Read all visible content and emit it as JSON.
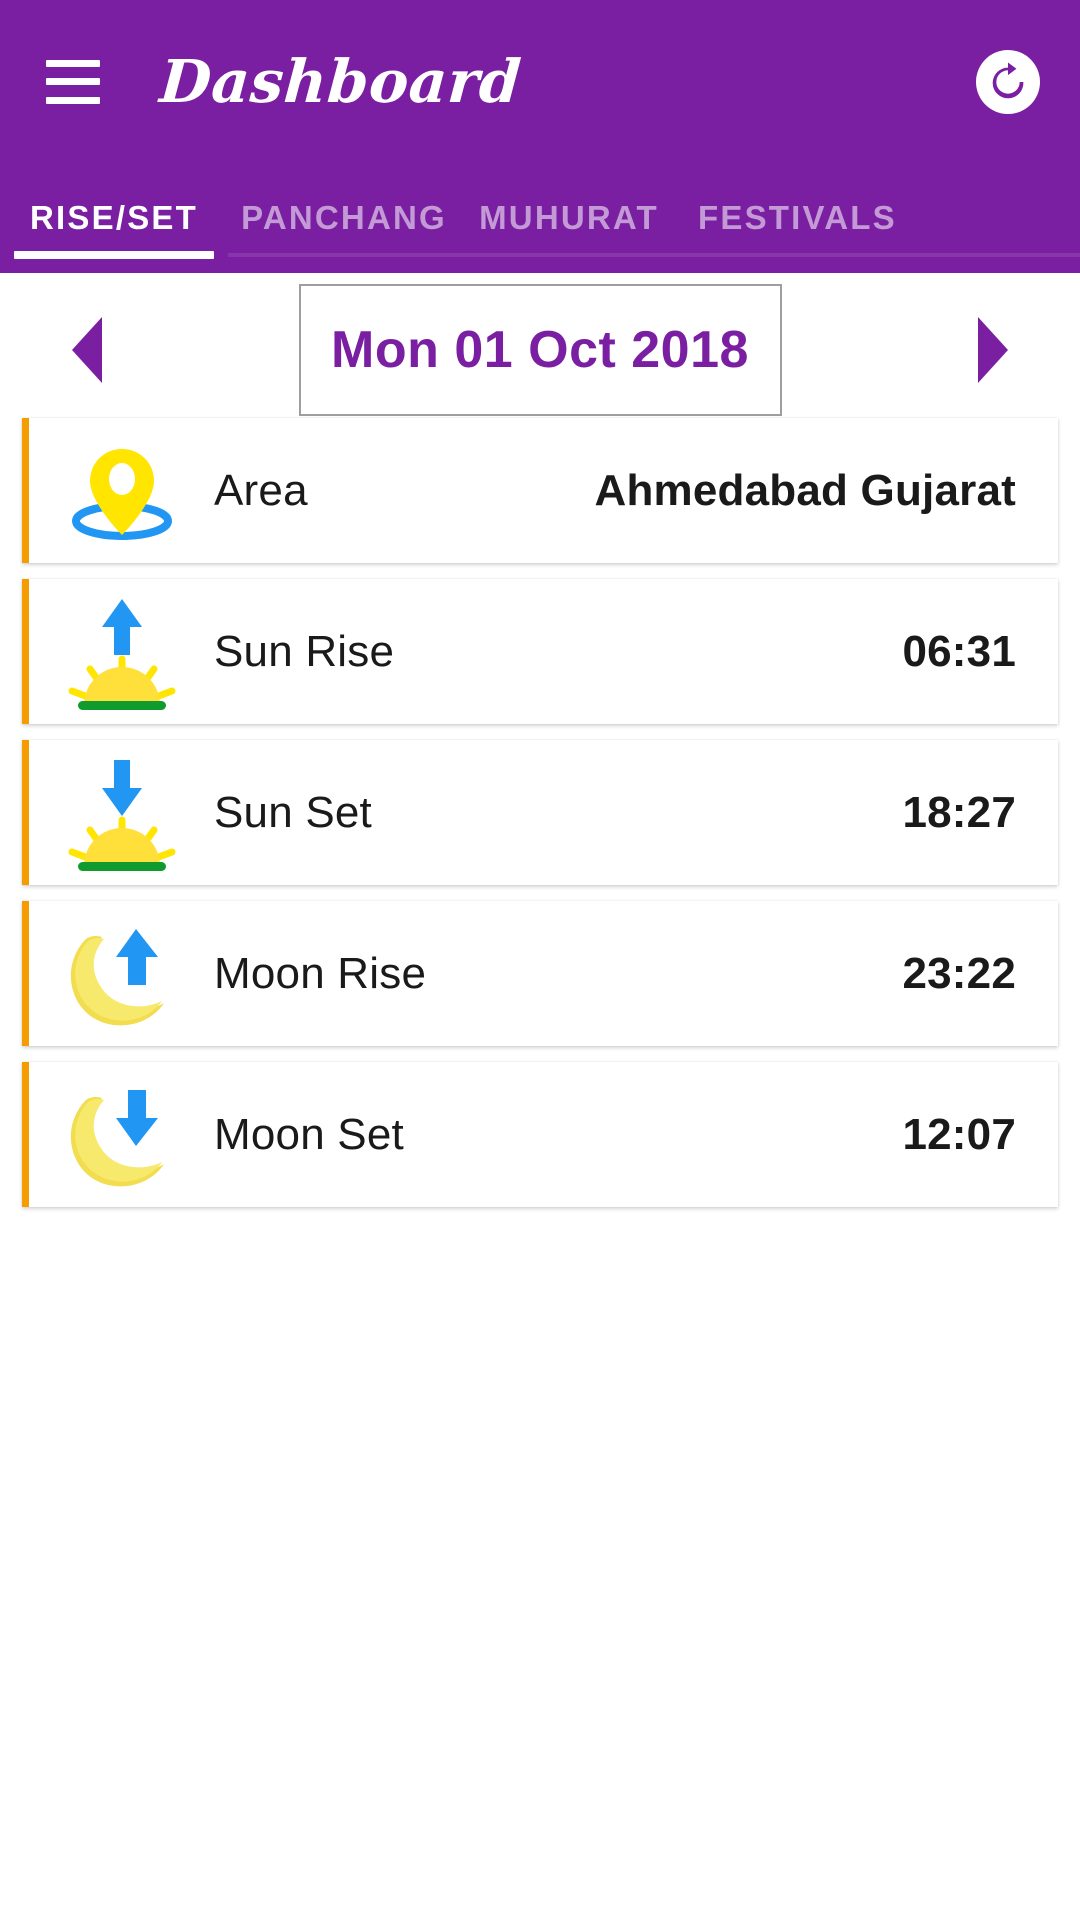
{
  "header": {
    "title": "Dashboard",
    "menu_icon": "hamburger-menu-icon",
    "refresh_icon": "refresh-icon",
    "background_color": "#7A1FA2"
  },
  "tabs": {
    "active_index": 0,
    "items": [
      {
        "label": "RISE/SET"
      },
      {
        "label": "PANCHANG"
      },
      {
        "label": "MUHURAT"
      },
      {
        "label": "FESTIVALS"
      }
    ]
  },
  "date_selector": {
    "prev_icon": "triangle-left-icon",
    "next_icon": "triangle-right-icon",
    "value": "Mon 01 Oct 2018",
    "accent_color": "#7A1FA2",
    "border_color": "#9E9E9E"
  },
  "list": {
    "accent_bar_color": "#F59C00",
    "rows": [
      {
        "icon": "location-pin-icon",
        "label": "Area",
        "value": "Ahmedabad Gujarat"
      },
      {
        "icon": "sunrise-icon",
        "label": "Sun Rise",
        "value": "06:31"
      },
      {
        "icon": "sunset-icon",
        "label": "Sun Set",
        "value": "18:27"
      },
      {
        "icon": "moonrise-icon",
        "label": "Moon Rise",
        "value": "23:22"
      },
      {
        "icon": "moonset-icon",
        "label": "Moon Set",
        "value": "12:07"
      }
    ]
  }
}
